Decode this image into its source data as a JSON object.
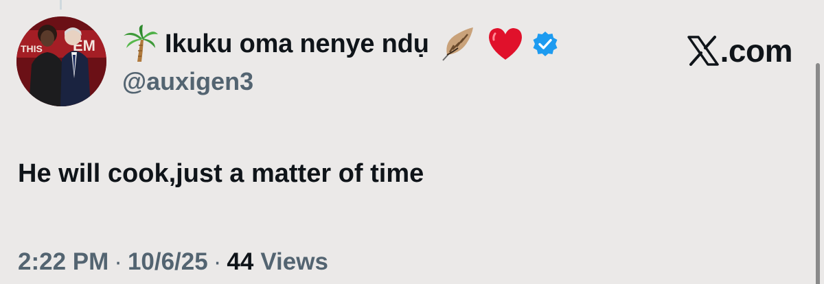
{
  "author": {
    "display_name": "Ikuku oma nenye ndụ",
    "handle": "@auxigen3",
    "verified": true,
    "name_emojis": [
      "palm-tree",
      "feather",
      "red-heart"
    ]
  },
  "brand": {
    "text": ".com"
  },
  "post": {
    "text": "He will cook,just a matter of time"
  },
  "meta": {
    "time": "2:22 PM",
    "date": "10/6/25",
    "separator": "·",
    "views_count": "44",
    "views_label": "Views"
  },
  "colors": {
    "background": "#ebe9e8",
    "text_primary": "#0f1419",
    "text_secondary": "#536471",
    "verified_blue": "#1d9bf0",
    "heart_red": "#e0112b"
  }
}
